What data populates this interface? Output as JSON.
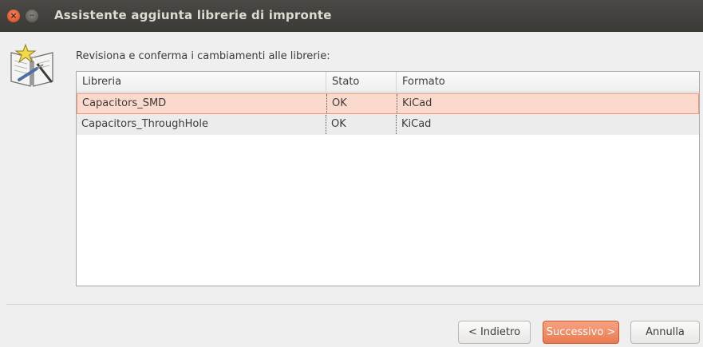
{
  "window": {
    "title": "Assistente aggiunta librerie di impronte",
    "close_glyph": "×",
    "minimize_glyph": "−"
  },
  "instruction": "Revisiona e conferma i cambiamenti alle librerie:",
  "table": {
    "headers": {
      "library": "Libreria",
      "status": "Stato",
      "format": "Formato"
    },
    "rows": [
      {
        "library": "Capacitors_SMD",
        "status": "OK",
        "format": "KiCad",
        "selected": true
      },
      {
        "library": "Capacitors_ThroughHole",
        "status": "OK",
        "format": "KiCad",
        "selected": false
      }
    ]
  },
  "buttons": {
    "back": "< Indietro",
    "next": "Successivo >",
    "cancel": "Annulla"
  },
  "colors": {
    "titlebar": "#3b3a36",
    "accent": "#ea7a50",
    "selection": "#fbd9cc",
    "close": "#e2582a"
  },
  "icons": {
    "wizard": "book-wizard-icon"
  }
}
